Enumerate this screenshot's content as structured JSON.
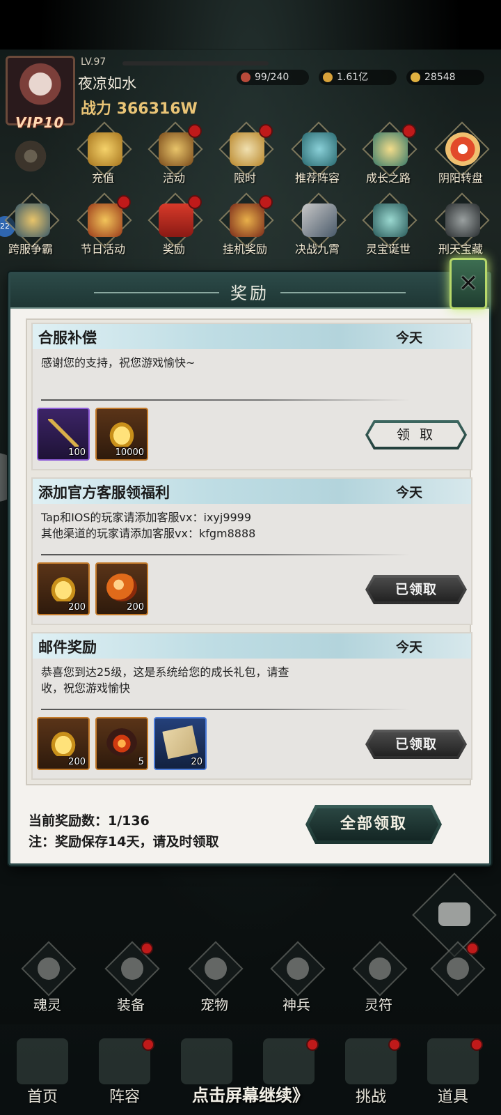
{
  "player": {
    "level": "LV.97",
    "name": "夜凉如水",
    "power": "战力 366316W",
    "vip": "VIP10"
  },
  "resources": [
    {
      "icon": "stamina-icon",
      "value": "99/240",
      "color": "#b84a3a"
    },
    {
      "icon": "coin-icon",
      "value": "1.61亿",
      "color": "#d8a23a"
    },
    {
      "icon": "ingot-icon",
      "value": "28548",
      "color": "#e0b040"
    }
  ],
  "activities_row1": [
    {
      "label": "充值",
      "badge": false
    },
    {
      "label": "活动",
      "badge": true
    },
    {
      "label": "限时",
      "badge": true
    },
    {
      "label": "推荐阵容",
      "badge": false
    },
    {
      "label": "成长之路",
      "badge": true
    },
    {
      "label": "阴阳转盘",
      "badge": false
    }
  ],
  "activities_row2": [
    {
      "label": "跨服争霸",
      "badge": false
    },
    {
      "label": "节日活动",
      "badge": true
    },
    {
      "label": "奖励",
      "badge": true
    },
    {
      "label": "挂机奖励",
      "badge": true
    },
    {
      "label": "决战九霄",
      "badge": false
    },
    {
      "label": "灵宝诞世",
      "badge": false
    },
    {
      "label": "刑天宝藏",
      "badge": false
    }
  ],
  "side_badge": "22",
  "panel": {
    "title": "奖励",
    "close_label": "✕",
    "rewards": [
      {
        "title": "合服补偿",
        "date": "今天",
        "lines": [
          "感谢您的支持，祝您游戏愉快~"
        ],
        "items": [
          {
            "icon": "golden-branch-icon",
            "qty": "100",
            "rarity": "purple"
          },
          {
            "icon": "gold-ingot-icon",
            "qty": "10000",
            "rarity": "orange"
          }
        ],
        "button": "领 取",
        "claimed": false
      },
      {
        "title": "添加官方客服领福利",
        "date": "今天",
        "lines": [
          "Tap和IOS的玩家请添加客服vx：ixyj9999",
          "其他渠道的玩家请添加客服vx：kfgm8888"
        ],
        "items": [
          {
            "icon": "gold-ingot-icon",
            "qty": "200",
            "rarity": "orange"
          },
          {
            "icon": "fire-orb-icon",
            "qty": "200",
            "rarity": "orange"
          }
        ],
        "button": "已领取",
        "claimed": true
      },
      {
        "title": "邮件奖励",
        "date": "今天",
        "lines": [
          "恭喜您到达25级，这是系统给您的成长礼包，请查",
          "收，祝您游戏愉快"
        ],
        "items": [
          {
            "icon": "gold-ingot-icon",
            "qty": "200",
            "rarity": "orange"
          },
          {
            "icon": "flame-orb-icon",
            "qty": "5",
            "rarity": "orange"
          },
          {
            "icon": "scroll-icon",
            "qty": "20",
            "rarity": "blue"
          }
        ],
        "button": "已领取",
        "claimed": true
      }
    ],
    "count_text": "当前奖励数：1/136",
    "note_text": "注：奖励保存14天，请及时领取",
    "claim_all": "全部领取"
  },
  "sub_nav": [
    {
      "label": "魂灵",
      "badge": false
    },
    {
      "label": "装备",
      "badge": true
    },
    {
      "label": "宠物",
      "badge": false
    },
    {
      "label": "神兵",
      "badge": false
    },
    {
      "label": "灵符",
      "badge": false
    },
    {
      "label": "",
      "badge": true
    }
  ],
  "main_nav": [
    {
      "label": "首页",
      "badge": false
    },
    {
      "label": "阵容",
      "badge": true
    },
    {
      "label": "",
      "badge": false
    },
    {
      "label": "",
      "badge": true
    },
    {
      "label": "挑战",
      "badge": true
    },
    {
      "label": "道具",
      "badge": true
    }
  ],
  "continue_text": "点击屏幕继续》"
}
